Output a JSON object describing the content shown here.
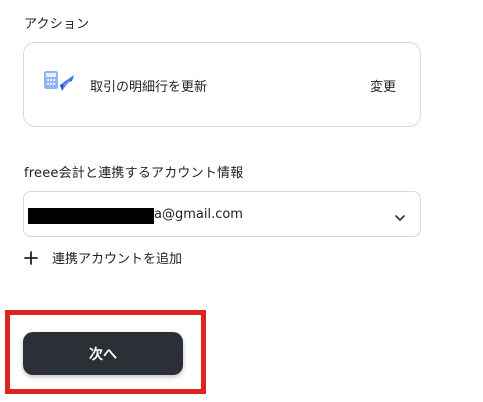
{
  "action": {
    "section_label": "アクション",
    "card": {
      "icon": "freee-accounting-icon",
      "text": "取引の明細行を更新",
      "change_label": "変更"
    }
  },
  "account": {
    "section_label": "freee会計と連携するアカウント情報",
    "selected_email_visible": "a@gmail.com",
    "add_account_label": "連携アカウントを追加"
  },
  "footer": {
    "next_label": "次へ"
  },
  "colors": {
    "next_button_bg": "#2b2f36",
    "highlight_frame": "#e0231f",
    "border": "#d5d9de",
    "freee_blue": "#2864f0"
  }
}
